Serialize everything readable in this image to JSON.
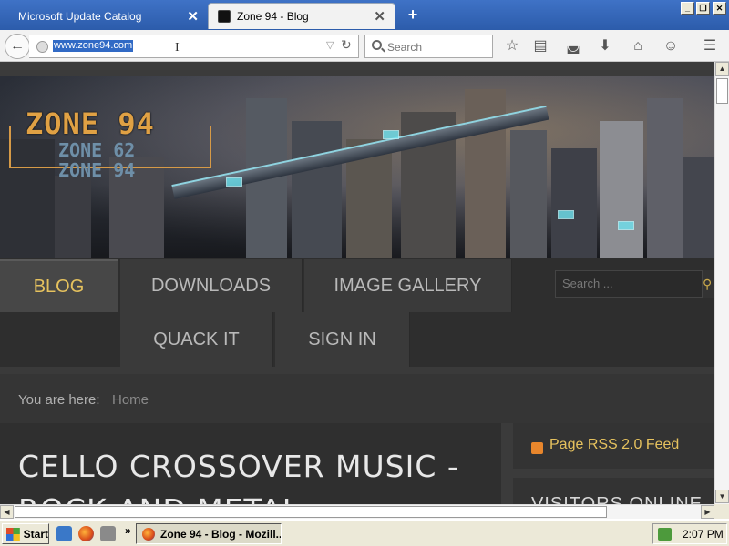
{
  "browser": {
    "tabs": [
      {
        "label": "Microsoft Update Catalog",
        "close": "✕"
      },
      {
        "label": "Zone 94 - Blog",
        "close": "✕"
      }
    ],
    "new_tab": "+",
    "window_buttons": {
      "minimize": "_",
      "maximize": "❐",
      "close": "✕"
    },
    "url": "www.zone94.com",
    "search_placeholder": "Search",
    "toolbar_icons": [
      "bookmark-star-icon",
      "reading-list-icon",
      "pocket-icon",
      "download-icon",
      "home-icon",
      "hello-icon",
      "menu-icon"
    ]
  },
  "site": {
    "logo": {
      "main": "ZONE 94",
      "sub1": "ZONE 62",
      "sub2": "ZONE 94"
    },
    "menu": {
      "blog": "BLOG",
      "downloads": "DOWNLOADS",
      "image_gallery": "IMAGE GALLERY",
      "quack_it": "QUACK IT",
      "sign_in": "SIGN IN"
    },
    "search_placeholder": "Search ...",
    "breadcrumb": {
      "label": "You are here:",
      "home": "Home"
    },
    "article_title": "CELLO CROSSOVER MUSIC - ROCK AND METAL",
    "sidebar": {
      "rss": "Page RSS 2.0 Feed",
      "visitors": "VISITORS ONLINE"
    }
  },
  "taskbar": {
    "start": "Start",
    "quick_launch_more": "»",
    "task": "Zone 94 - Blog - Mozill...",
    "clock": "2:07 PM"
  },
  "colors": {
    "accent_gold": "#e6c25e",
    "logo_orange": "#e0a144",
    "xp_blue": "#2c5cab"
  }
}
